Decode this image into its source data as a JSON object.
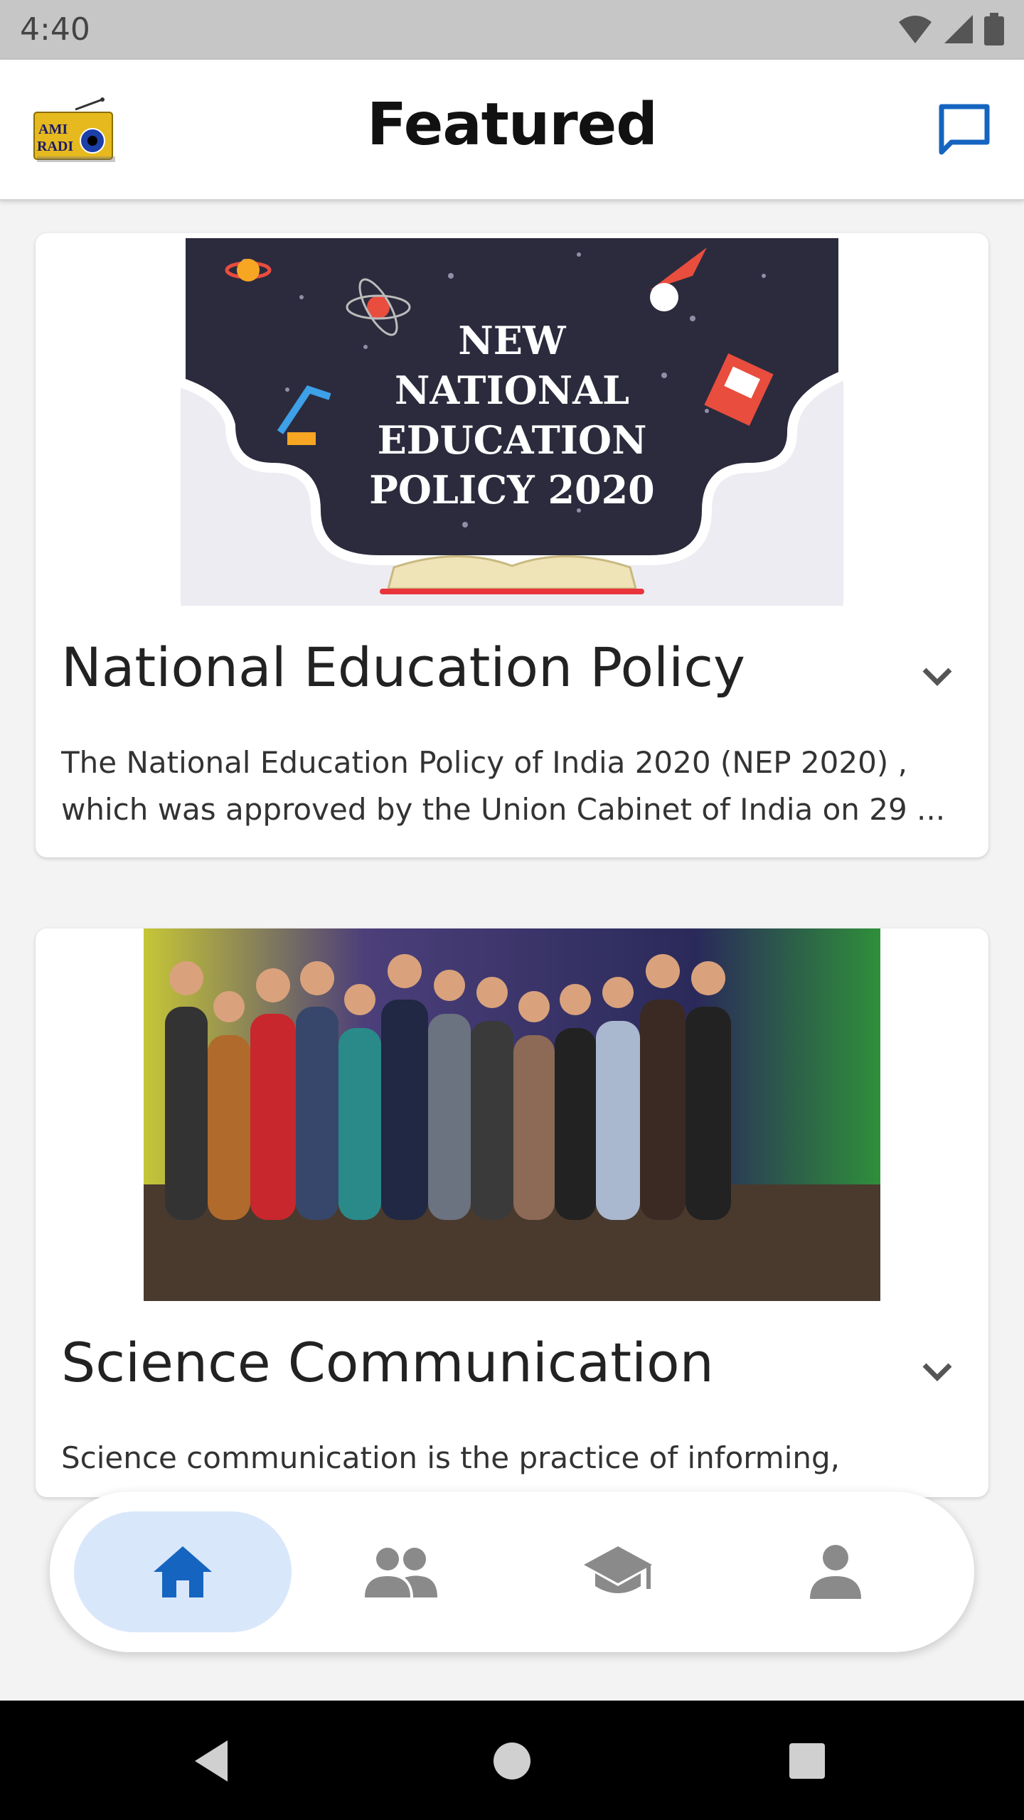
{
  "status_bar": {
    "time": "4:40"
  },
  "header": {
    "title": "Featured",
    "logo_text": [
      "AMI",
      "RADI"
    ]
  },
  "cards": [
    {
      "title": "National Education Policy",
      "image_text": [
        "NEW",
        "NATIONAL",
        "EDUCATION",
        "POLICY 2020"
      ],
      "description_lines": [
        "The National Education Policy of India 2020 (NEP 2020) ,",
        "which was approved by the Union Cabinet of India on 29 ..."
      ]
    },
    {
      "title": "Science Communication",
      "description_lines": [
        "Science communication is  the practice of informing,"
      ]
    }
  ],
  "bottom_nav": {
    "items": [
      {
        "icon": "home-icon",
        "active": true
      },
      {
        "icon": "people-icon",
        "active": false
      },
      {
        "icon": "school-icon",
        "active": false
      },
      {
        "icon": "person-icon",
        "active": false
      }
    ]
  },
  "colors": {
    "accent": "#1565c0",
    "nav_active_bg": "#d9e7fb",
    "nav_inactive": "#8a8a8a",
    "poster_bg": "#2b2b3d"
  }
}
